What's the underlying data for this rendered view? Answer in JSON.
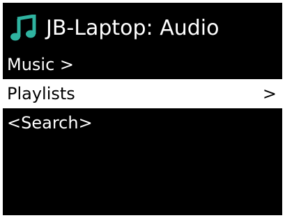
{
  "header": {
    "icon": "music-note-icon",
    "title": "JB-Laptop: Audio"
  },
  "colors": {
    "background": "#000000",
    "text": "#ffffff",
    "accent": "#2fb3a0",
    "highlight_bg": "#ffffff",
    "highlight_text": "#000000"
  },
  "menu": {
    "items": [
      {
        "label": "Music >",
        "arrow": ""
      },
      {
        "label": "Playlists",
        "arrow": ">",
        "selected": true
      },
      {
        "label": "<Search>",
        "arrow": ""
      }
    ]
  }
}
